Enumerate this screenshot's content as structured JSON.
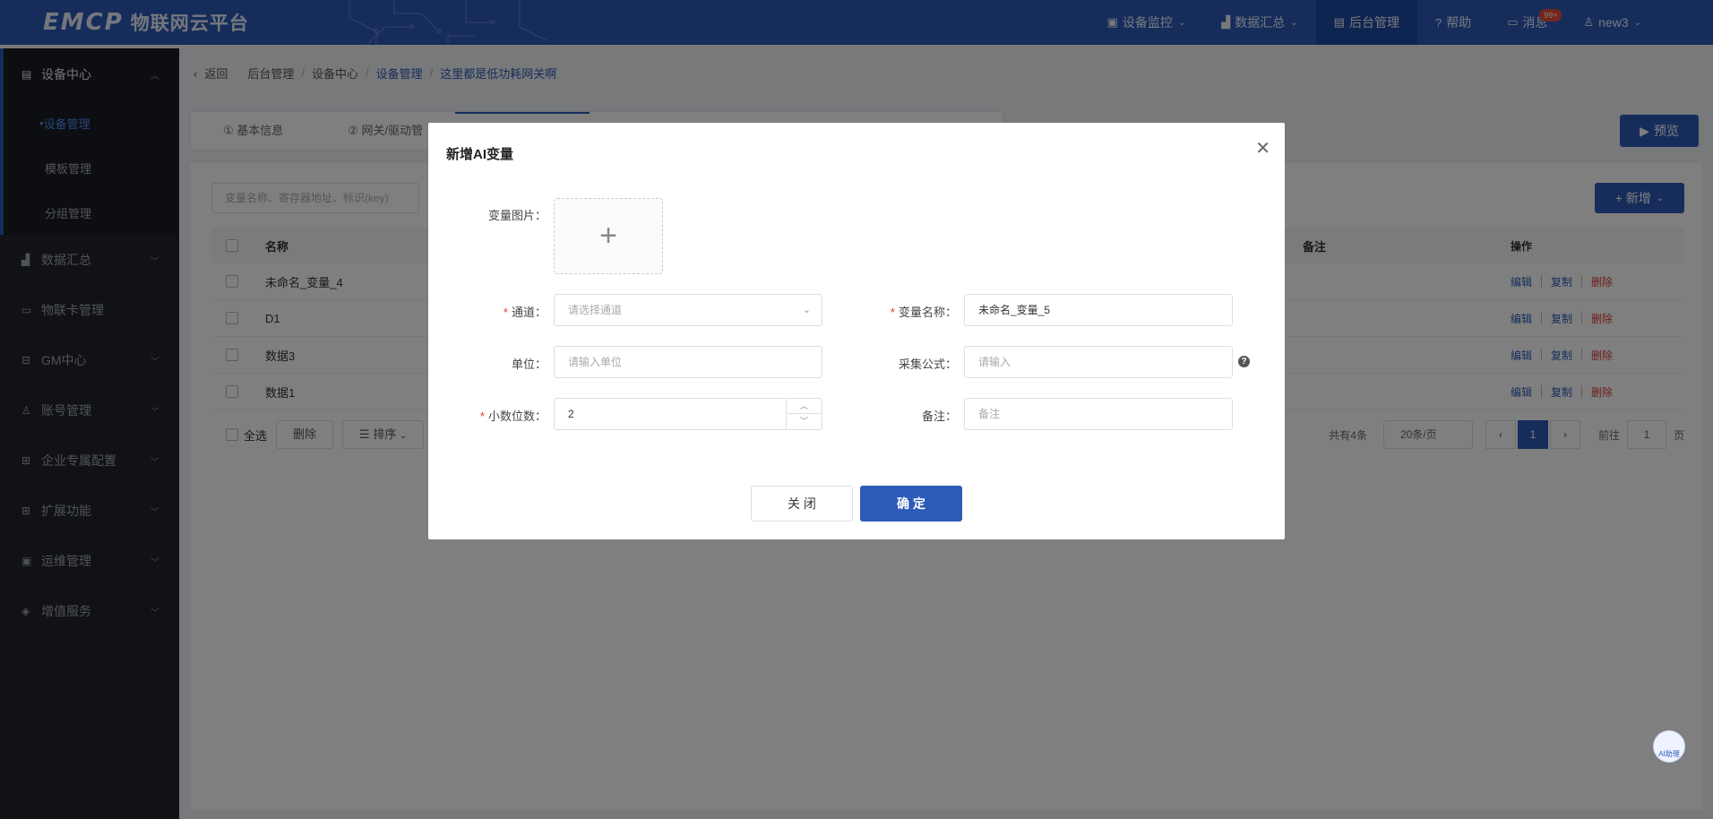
{
  "header": {
    "logo_en": "EMCP",
    "logo_cn": "物联网云平台",
    "nav": [
      {
        "label": "设备监控",
        "icon": "monitor-icon"
      },
      {
        "label": "数据汇总",
        "icon": "chart-icon"
      },
      {
        "label": "后台管理",
        "icon": "admin-icon"
      },
      {
        "label": "帮助",
        "icon": "help-icon"
      },
      {
        "label": "消息",
        "icon": "message-icon",
        "badge": "99+"
      },
      {
        "label": "new3",
        "icon": "user-icon"
      }
    ]
  },
  "sidebar": {
    "group": "设备中心",
    "sub_items": [
      "设备管理",
      "模板管理",
      "分组管理"
    ],
    "items": [
      "数据汇总",
      "物联卡管理",
      "GM中心",
      "账号管理",
      "企业专属配置",
      "扩展功能",
      "运维管理",
      "增值服务"
    ]
  },
  "breadcrumb": {
    "back": "返回",
    "items": [
      "后台管理",
      "设备中心",
      "设备管理",
      "这里都是低功耗网关啊"
    ]
  },
  "tabs": [
    "① 基本信息",
    "② 网关/驱动管"
  ],
  "preview_label": "预览",
  "list": {
    "search_placeholder": "变量名称、寄存器地址、标识(key)",
    "add_label": "新增",
    "columns": {
      "name": "名称",
      "note": "备注",
      "ops": "操作"
    },
    "rows": [
      {
        "name": "未命名_变量_4"
      },
      {
        "name": "D1"
      },
      {
        "name": "数据3"
      },
      {
        "name": "数据1"
      }
    ],
    "ops": {
      "edit": "编辑",
      "copy": "复制",
      "delete": "删除"
    },
    "footer": {
      "select_all": "全选",
      "delete": "删除",
      "sort": "排序",
      "total": "共有4条",
      "page_size": "20条/页",
      "current_page": "1",
      "goto_prefix": "前往",
      "goto_value": "1",
      "goto_suffix": "页"
    }
  },
  "dialog": {
    "title": "新增AI变量",
    "image_label": "变量图片：",
    "channel_label": "通道：",
    "channel_placeholder": "请选择通道",
    "var_name_label": "变量名称：",
    "var_name_value": "未命名_变量_5",
    "unit_label": "单位：",
    "unit_placeholder": "请输入单位",
    "formula_label": "采集公式：",
    "formula_placeholder": "请输入",
    "decimals_label": "小数位数：",
    "decimals_value": "2",
    "note_label": "备注：",
    "note_placeholder": "备注",
    "close_label": "关 闭",
    "ok_label": "确 定"
  },
  "ai_assistant": "AI助理"
}
